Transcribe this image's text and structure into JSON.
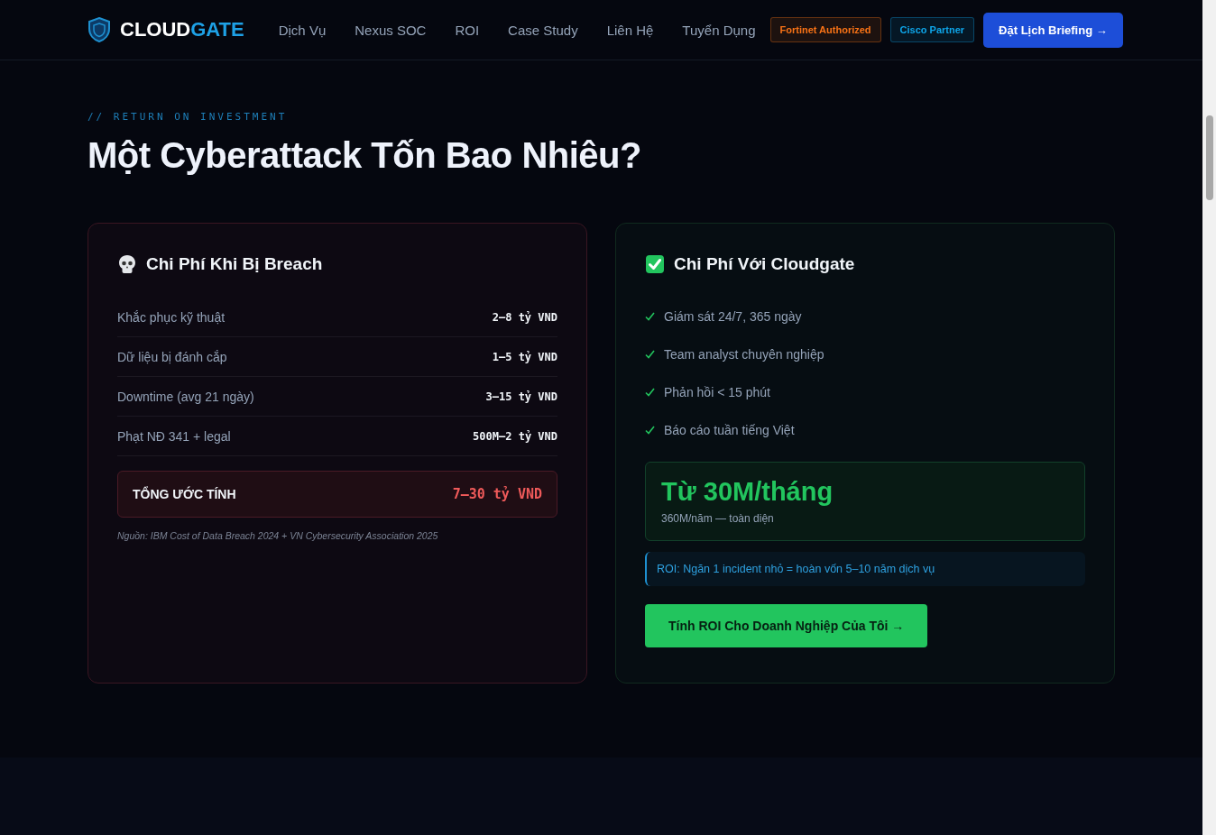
{
  "nav": {
    "logo": {
      "first": "CLOUD",
      "second": "GATE"
    },
    "links": [
      "Dịch Vụ",
      "Nexus SOC",
      "ROI",
      "Case Study",
      "Liên Hệ",
      "Tuyển Dụng"
    ],
    "badges": [
      {
        "label": "Fortinet Authorized",
        "color": "#f97316"
      },
      {
        "label": "Cisco Partner",
        "color": "#0ea5e9"
      }
    ],
    "cta": "Đặt Lịch Briefing →"
  },
  "section": {
    "eyebrow": "// RETURN ON INVESTMENT",
    "title": "Một Cyberattack Tốn Bao Nhiêu?"
  },
  "breach_card": {
    "title": "Chi Phí Khi Bị Breach",
    "rows": [
      {
        "label": "Khắc phục kỹ thuật",
        "value": "2–8 tỷ VND"
      },
      {
        "label": "Dữ liệu bị đánh cắp",
        "value": "1–5 tỷ VND"
      },
      {
        "label": "Downtime (avg 21 ngày)",
        "value": "3–15 tỷ VND"
      },
      {
        "label": "Phạt NĐ 341 + legal",
        "value": "500M–2 tỷ VND"
      }
    ],
    "total": {
      "label": "TỔNG ƯỚC TÍNH",
      "value": "7–30 tỷ VND"
    },
    "source": "Nguồn: IBM Cost of Data Breach 2024 + VN Cybersecurity Association 2025"
  },
  "cloudgate_card": {
    "title": "Chi Phí Với Cloudgate",
    "features": [
      "Giám sát 24/7, 365 ngày",
      "Team analyst chuyên nghiệp",
      "Phản hồi < 15 phút",
      "Báo cáo tuần tiếng Việt"
    ],
    "price": {
      "headline": "Từ 30M/tháng",
      "sub": "360M/năm — toàn diện"
    },
    "roi_note": "ROI: Ngăn 1 incident nhỏ = hoàn vốn 5–10 năm dịch vụ",
    "button": "Tính ROI Cho Doanh Nghiệp Của Tôi →"
  }
}
